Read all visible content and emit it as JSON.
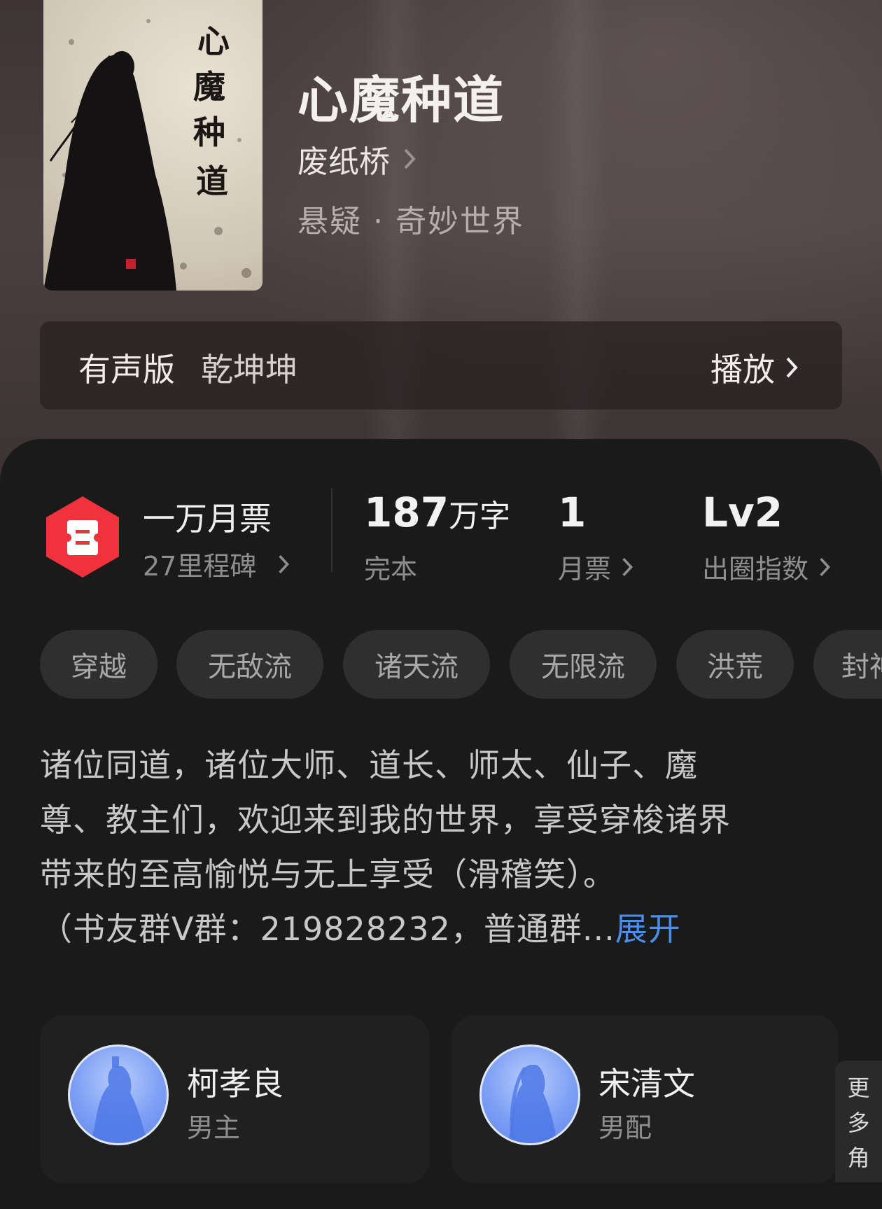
{
  "book": {
    "title": "心魔种道",
    "author": "废纸桥",
    "genre": "悬疑 · 奇妙世界",
    "cover_text": "心魔种道"
  },
  "audio": {
    "label": "有声版",
    "narrator": "乾坤坤",
    "play_label": "播放"
  },
  "stats": {
    "ticket_title": "一万月票",
    "ticket_sub": "27里程碑",
    "words_value": "187",
    "words_unit": "万字",
    "words_label": "完本",
    "monthly_value": "1",
    "monthly_label": "月票",
    "index_value": "Lv2",
    "index_label": "出圈指数"
  },
  "tags": [
    "穿越",
    "无敌流",
    "诸天流",
    "无限流",
    "洪荒",
    "封神"
  ],
  "synopsis": {
    "lines": [
      "诸位同道，诸位大师、道长、师太、仙子、魔",
      "尊、教主们，欢迎来到我的世界，享受穿梭诸界",
      "带来的至高愉悦与无上享受（滑稽笑）。",
      "（书友群V群：219828232，普通群..."
    ],
    "expand_label": "展开"
  },
  "characters": [
    {
      "name": "柯孝良",
      "role": "男主"
    },
    {
      "name": "宋清文",
      "role": "男配"
    }
  ],
  "more_label": [
    "更",
    "多",
    "角"
  ],
  "colors": {
    "accent_blue": "#4a8fe8",
    "badge_red": "#f0323c",
    "panel_bg": "#1a1a1a"
  },
  "icons": [
    "chevron-right-icon",
    "ticket-badge-icon"
  ]
}
